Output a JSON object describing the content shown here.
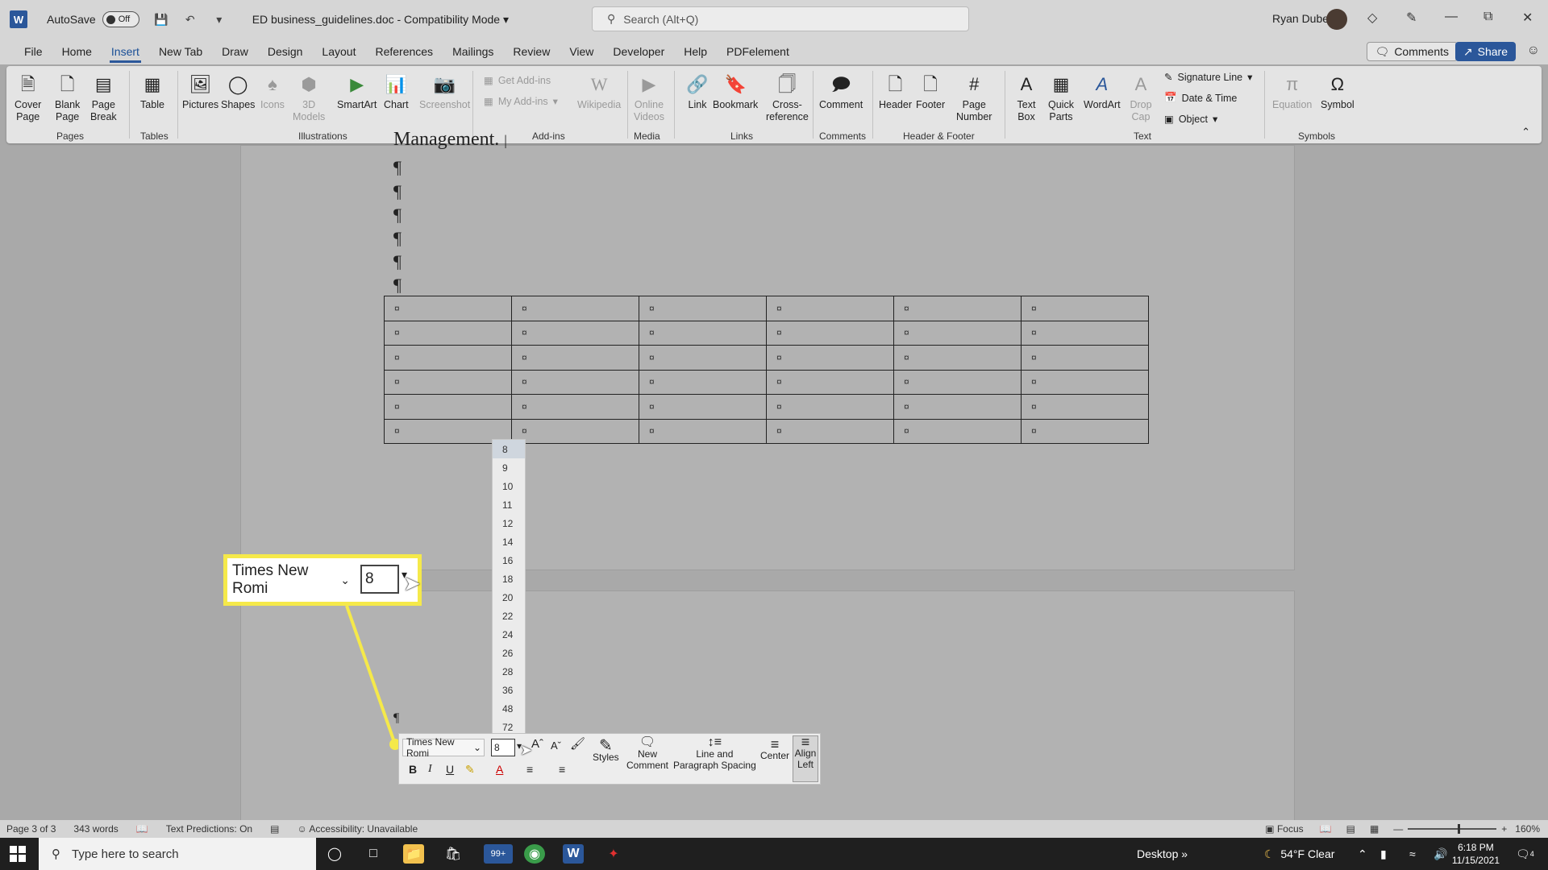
{
  "titlebar": {
    "autosave_label": "AutoSave",
    "autosave_state": "Off",
    "doc_title": "ED business_guidelines.doc  -  Compatibility Mode",
    "search_placeholder": "Search (Alt+Q)",
    "user_name": "Ryan Dube"
  },
  "menu": {
    "tabs": [
      "File",
      "Home",
      "Insert",
      "New Tab",
      "Draw",
      "Design",
      "Layout",
      "References",
      "Mailings",
      "Review",
      "View",
      "Developer",
      "Help",
      "PDFelement"
    ],
    "active_tab": "Insert",
    "comments_label": "Comments",
    "share_label": "Share"
  },
  "ribbon": {
    "pages": {
      "cover": "Cover\nPage",
      "blank": "Blank\nPage",
      "break": "Page\nBreak",
      "label": "Pages"
    },
    "tables": {
      "table": "Table",
      "label": "Tables"
    },
    "illustrations": {
      "pictures": "Pictures",
      "shapes": "Shapes",
      "icons": "Icons",
      "models": "3D\nModels",
      "smartart": "SmartArt",
      "chart": "Chart",
      "screenshot": "Screenshot",
      "label": "Illustrations"
    },
    "addins": {
      "get": "Get Add-ins",
      "my": "My Add-ins",
      "wikipedia": "Wikipedia",
      "label": "Add-ins"
    },
    "media": {
      "online_videos": "Online\nVideos",
      "label": "Media"
    },
    "links": {
      "link": "Link",
      "bookmark": "Bookmark",
      "crossref": "Cross-\nreference",
      "label": "Links"
    },
    "comments": {
      "comment": "Comment",
      "label": "Comments"
    },
    "header_footer": {
      "header": "Header",
      "footer": "Footer",
      "page_number": "Page\nNumber",
      "label": "Header & Footer"
    },
    "text": {
      "text_box": "Text\nBox",
      "quick_parts": "Quick\nParts",
      "wordart": "WordArt",
      "drop_cap": "Drop\nCap",
      "signature_line": "Signature Line",
      "date_time": "Date & Time",
      "object": "Object",
      "label": "Text"
    },
    "symbols": {
      "equation": "Equation",
      "symbol": "Symbol",
      "label": "Symbols"
    }
  },
  "document": {
    "heading_fragment": "Management.",
    "pilcrow": "¶",
    "cell_mark": "¤"
  },
  "font_size_list": [
    "8",
    "9",
    "10",
    "11",
    "12",
    "14",
    "16",
    "18",
    "20",
    "22",
    "24",
    "26",
    "28",
    "36",
    "48",
    "72"
  ],
  "callout": {
    "font_name": "Times New Romi",
    "font_size": "8"
  },
  "mini_toolbar": {
    "font_name": "Times New Romi",
    "font_size": "8",
    "bold": "B",
    "italic": "I",
    "underline": "U",
    "styles": "Styles",
    "new_comment": "New\nComment",
    "line_spacing": "Line and\nParagraph Spacing",
    "center": "Center",
    "align_left": "Align\nLeft"
  },
  "statusbar": {
    "page": "Page 3 of 3",
    "words": "343 words",
    "text_predictions": "Text Predictions: On",
    "accessibility": "Accessibility: Unavailable",
    "focus": "Focus",
    "zoom": "160%"
  },
  "taskbar": {
    "search_placeholder": "Type here to search",
    "badge": "99+",
    "desktop": "Desktop",
    "weather": "54°F  Clear",
    "time": "6:18 PM",
    "date": "11/15/2021",
    "notification_count": "4"
  },
  "colors": {
    "accent": "#2b579a",
    "callout": "#f5e94a"
  }
}
